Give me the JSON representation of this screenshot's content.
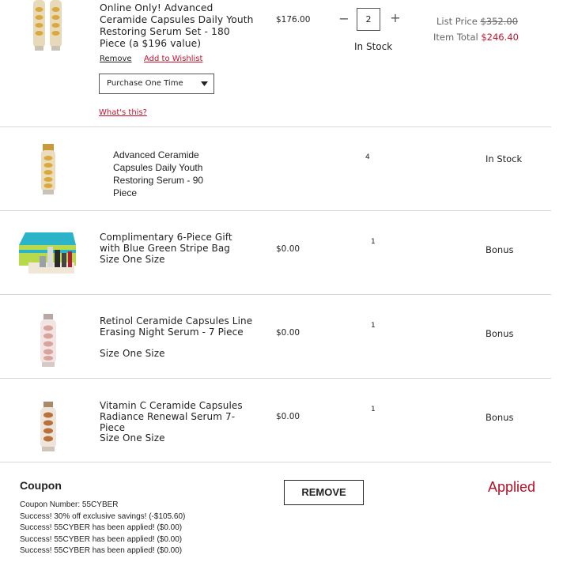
{
  "items": [
    {
      "name": "Online Only! Advanced Ceramide Capsules Daily Youth Restoring Serum Set - 180 Piece (a $196 value)",
      "price": "$176.00",
      "quantity": "2",
      "stock": "In Stock",
      "list_price_label": "List Price",
      "list_price": "$352.00",
      "item_total_label": "Item Total",
      "item_total": "$246.40",
      "remove_label": "Remove",
      "wishlist_label": "Add to Wishlist",
      "purchase_option": "Purchase One Time",
      "whats_this": "What's this?"
    },
    {
      "name": "Advanced Ceramide Capsules Daily Youth Restoring Serum - 90 Piece",
      "quantity": "4",
      "status": "In Stock"
    },
    {
      "name": "Complimentary 6-Piece Gift with Blue Green Stripe Bag",
      "size": "Size One Size",
      "price": "$0.00",
      "quantity": "1",
      "status": "Bonus"
    },
    {
      "name": "Retinol Ceramide Capsules Line Erasing Night Serum - 7 Piece",
      "size": "Size One Size",
      "price": "$0.00",
      "quantity": "1",
      "status": "Bonus"
    },
    {
      "name": "Vitamin C Ceramide Capsules Radiance Renewal Serum 7-Piece",
      "size": "Size One Size",
      "price": "$0.00",
      "quantity": "1",
      "status": "Bonus"
    }
  ],
  "coupon": {
    "title": "Coupon",
    "remove_label": "REMOVE",
    "status": "Applied",
    "number_line": "Coupon Number: 55CYBER",
    "messages": [
      "Success! 30% off exclusive savings! (-$105.60)",
      "Success! 55CYBER has been applied! ($0.00)",
      "Success! 55CYBER has been applied! ($0.00)",
      "Success! 55CYBER has been applied! ($0.00)"
    ]
  },
  "colors": {
    "accent_red": "#c8102e",
    "text": "#222222",
    "muted": "#666666",
    "divider": "#d6d6d6",
    "applied": "#b01227"
  },
  "icons": {
    "minus": "minus-icon",
    "plus": "plus-icon",
    "dropdown": "caret-down-icon"
  }
}
